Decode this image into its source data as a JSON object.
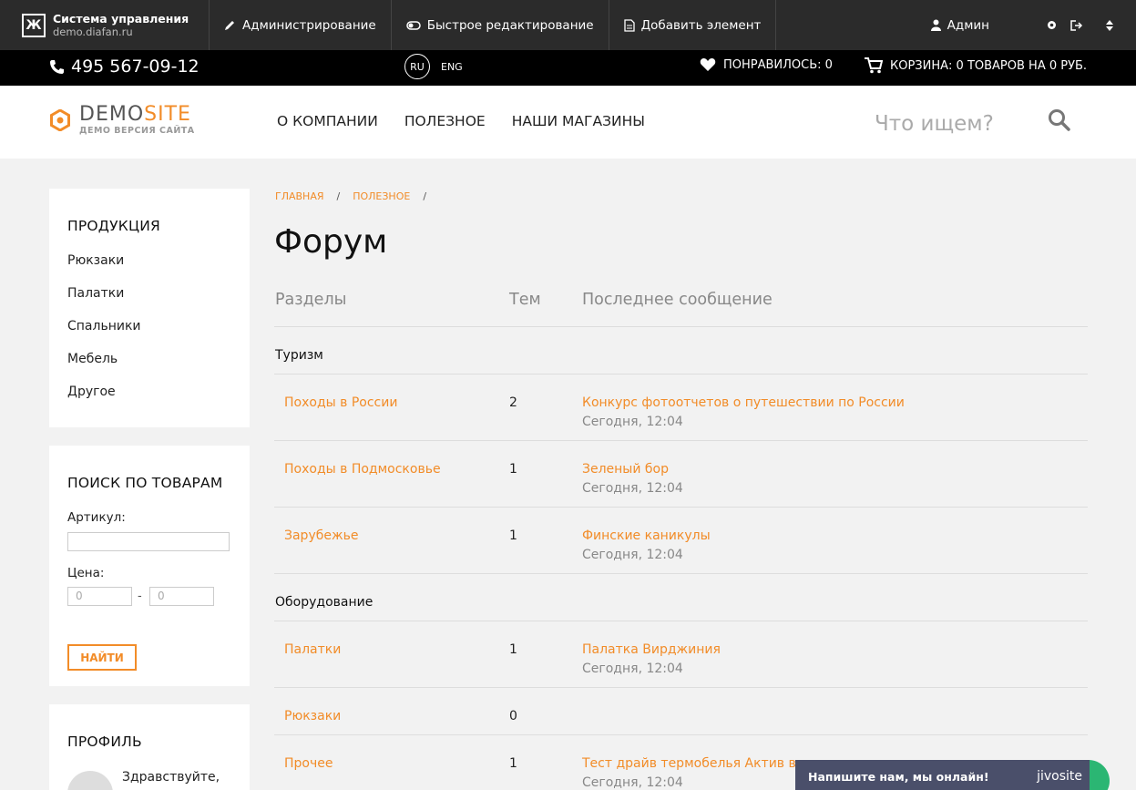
{
  "admin_bar": {
    "title": "Система управления",
    "domain": "demo.diafan.ru",
    "items": [
      "Администрирование",
      "Быстрое редактирование",
      "Добавить элемент"
    ],
    "user": "Админ"
  },
  "top_bar": {
    "phone": "495 567-09-12",
    "lang_ru": "RU",
    "lang_eng": "ENG",
    "likes": "ПОНРАВИЛОСЬ: 0",
    "cart": "КОРЗИНА: 0 ТОВАРОВ НА 0 РУБ."
  },
  "header": {
    "brand_demo": "DEMO",
    "brand_site": "SITE",
    "brand_sub": "ДЕМО ВЕРСИЯ САЙТА",
    "nav": [
      "О КОМПАНИИ",
      "ПОЛЕЗНОЕ",
      "НАШИ МАГАЗИНЫ"
    ],
    "search_placeholder": "Что ищем?"
  },
  "sidebar": {
    "products_title": "ПРОДУКЦИЯ",
    "products": [
      "Рюкзаки",
      "Палатки",
      "Спальники",
      "Мебель",
      "Другое"
    ],
    "search_title": "ПОИСК ПО ТОВАРАМ",
    "article_label": "Артикул:",
    "price_label": "Цена:",
    "price_from": "0",
    "price_to": "0",
    "price_dash": "-",
    "find_button": "НАЙТИ",
    "profile_title": "ПРОФИЛЬ",
    "profile_hello": "Здравствуйте,"
  },
  "main": {
    "breadcrumb": [
      "ГЛАВНАЯ",
      "ПОЛЕЗНОЕ"
    ],
    "breadcrumb_sep": "/",
    "title": "Форум",
    "col_sections": "Разделы",
    "col_topics": "Тем",
    "col_last": "Последнее сообщение",
    "sections": [
      {
        "title": "Туризм",
        "rows": [
          {
            "name": "Походы в России",
            "count": "2",
            "last": "Конкурс фотоотчетов о путешествии по России",
            "date": "Сегодня, 12:04"
          },
          {
            "name": "Походы в Подмосковье",
            "count": "1",
            "last": "Зеленый бор",
            "date": "Сегодня, 12:04"
          },
          {
            "name": "Зарубежье",
            "count": "1",
            "last": "Финские каникулы",
            "date": "Сегодня, 12:04"
          }
        ]
      },
      {
        "title": "Оборудование",
        "rows": [
          {
            "name": "Палатки",
            "count": "1",
            "last": "Палатка Вирджиния",
            "date": "Сегодня, 12:04"
          },
          {
            "name": "Рюкзаки",
            "count": "0",
            "last": "",
            "date": ""
          },
          {
            "name": "Прочее",
            "count": "1",
            "last": "Тест драйв термобелья Актив в усл",
            "date": "Сегодня, 12:04"
          }
        ]
      }
    ]
  },
  "chat": {
    "text": "Напишите нам, мы онлайн!",
    "brand": "jivosite"
  }
}
